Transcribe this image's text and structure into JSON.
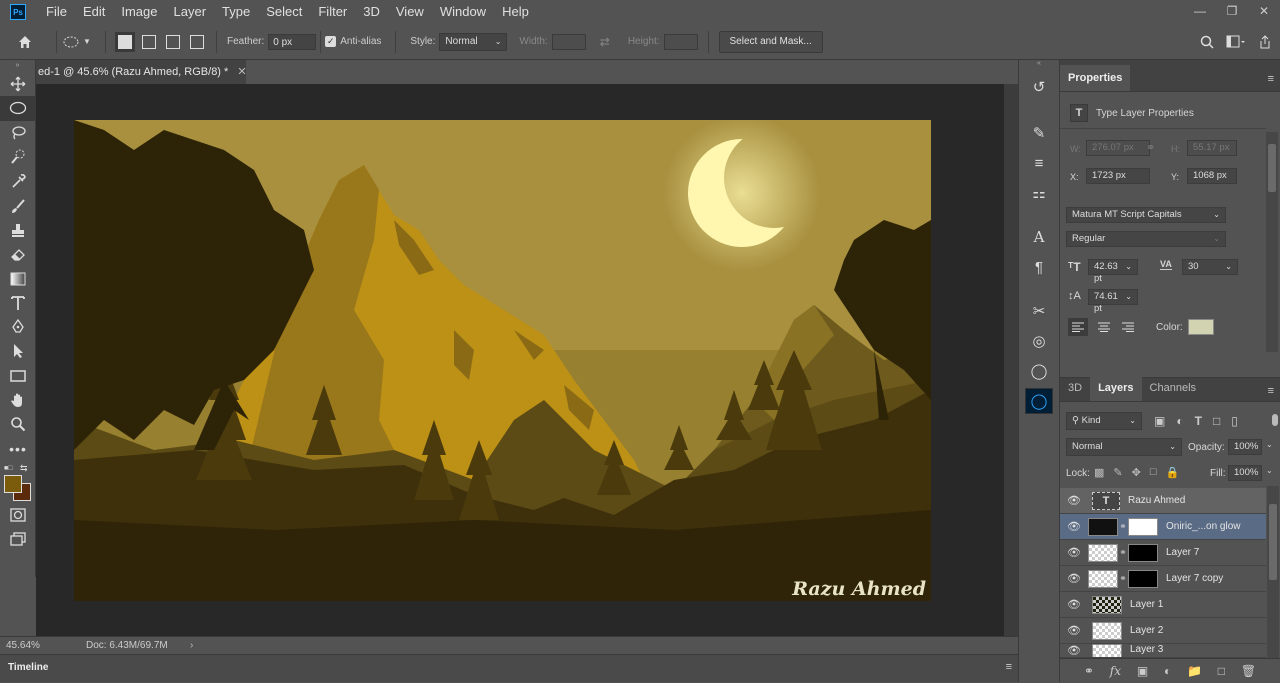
{
  "app": {
    "logo": "Ps"
  },
  "menu": [
    "File",
    "Edit",
    "Image",
    "Layer",
    "Type",
    "Select",
    "Filter",
    "3D",
    "View",
    "Window",
    "Help"
  ],
  "window_controls": [
    "minimize-icon",
    "restore-icon",
    "close-icon"
  ],
  "options": {
    "feather_label": "Feather:",
    "feather_value": "0 px",
    "antialias_label": "Anti-alias",
    "antialias_checked": true,
    "style_label": "Style:",
    "style_value": "Normal",
    "width_label": "Width:",
    "height_label": "Height:",
    "select_mask": "Select and Mask..."
  },
  "document": {
    "tab_title": "ed-1 @ 45.6% (Razu Ahmed, RGB/8) *",
    "watermark": "Razu Ahmed",
    "zoom": "45.64%",
    "doc_size": "Doc: 6.43M/69.7M"
  },
  "timeline": {
    "label": "Timeline"
  },
  "colors": {
    "foreground": "#7a5c0c",
    "background": "#5a2a0a",
    "canvas_sky": "#a8903f",
    "moon": "#fff7b0"
  },
  "properties": {
    "tab": "Properties",
    "subtitle": "Type Layer Properties",
    "w_label": "W:",
    "w_value": "276.07 px",
    "h_label": "H:",
    "h_value": "55.17 px",
    "x_label": "X:",
    "x_value": "1723 px",
    "y_label": "Y:",
    "y_value": "1068 px",
    "font_family": "Matura MT Script Capitals",
    "font_style": "Regular",
    "font_size": "42.63 pt",
    "tracking": "30",
    "leading": "74.61 pt",
    "color_label": "Color:",
    "text_color": "#d2d3b0"
  },
  "layers_panel": {
    "tabs": [
      "3D",
      "Layers",
      "Channels"
    ],
    "active_tab": "Layers",
    "filter": "Kind",
    "blend_mode": "Normal",
    "opacity_label": "Opacity:",
    "opacity": "100%",
    "lock_label": "Lock:",
    "fill_label": "Fill:",
    "fill": "100%",
    "layers": [
      {
        "name": "Razu Ahmed",
        "type": "text"
      },
      {
        "name": "Oniric_...on glow",
        "type": "masked"
      },
      {
        "name": "Layer 7",
        "type": "masked"
      },
      {
        "name": "Layer 7 copy",
        "type": "masked"
      },
      {
        "name": "Layer 1",
        "type": "pixel"
      },
      {
        "name": "Layer 2",
        "type": "pixel"
      },
      {
        "name": "Layer 3",
        "type": "pixel"
      }
    ]
  }
}
